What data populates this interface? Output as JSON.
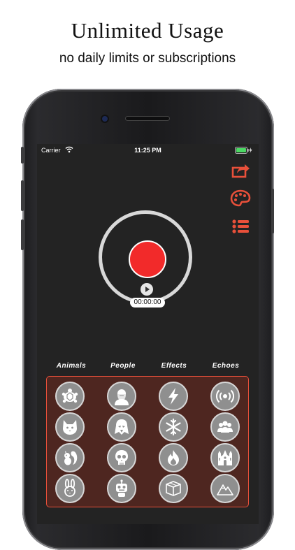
{
  "promo": {
    "headline": "Unlimited Usage",
    "subline": "no daily limits or subscriptions"
  },
  "statusbar": {
    "carrier": "Carrier",
    "time": "11:25 PM"
  },
  "recorder": {
    "timer": "00:00:00"
  },
  "categories": [
    "Animals",
    "People",
    "Effects",
    "Echoes"
  ],
  "tools": [
    "share-icon",
    "palette-icon",
    "list-icon"
  ],
  "colors": {
    "accent": "#e8503a",
    "record": "#f22a2a",
    "panel": "#4e2620",
    "screen": "#232323"
  },
  "sounds": [
    [
      "turtle-icon",
      "old-man-icon",
      "lightning-icon",
      "broadcast-icon"
    ],
    [
      "cat-icon",
      "darth-vader-icon",
      "snowflake-icon",
      "group-icon"
    ],
    [
      "squirrel-icon",
      "skull-icon",
      "fire-icon",
      "cathedral-icon"
    ],
    [
      "rabbit-icon",
      "robot-icon",
      "box-icon",
      "mountain-icon"
    ]
  ]
}
